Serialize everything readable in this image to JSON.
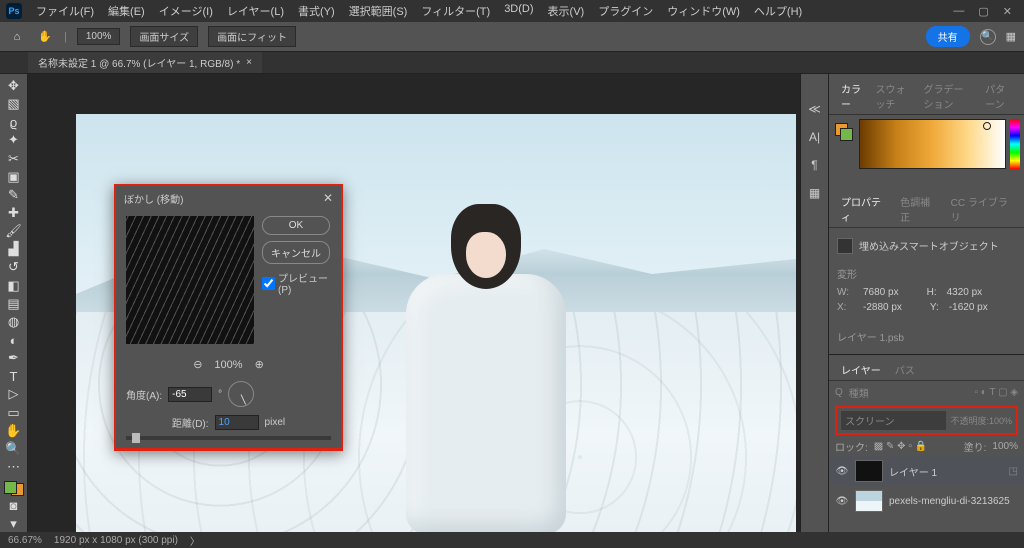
{
  "app": {
    "logo": "Ps"
  },
  "menu": [
    "ファイル(F)",
    "編集(E)",
    "イメージ(I)",
    "レイヤー(L)",
    "書式(Y)",
    "選択範囲(S)",
    "フィルター(T)",
    "3D(D)",
    "表示(V)",
    "プラグイン",
    "ウィンドウ(W)",
    "ヘルプ(H)"
  ],
  "optbar": {
    "zoom": "100%",
    "fit_screen": "画面サイズ",
    "fit_window": "画面にフィット",
    "share": "共有"
  },
  "tab": {
    "title": "名称未設定 1 @ 66.7% (レイヤー 1, RGB/8) *"
  },
  "dialog": {
    "title": "ぼかし (移動)",
    "ok": "OK",
    "cancel": "キャンセル",
    "preview_label": "プレビュー(P)",
    "zoom_pct": "100%",
    "angle_label": "角度(A):",
    "angle_value": "-65",
    "angle_unit": "°",
    "distance_label": "距離(D):",
    "distance_value": "10",
    "distance_unit": "pixel"
  },
  "right_tabs": {
    "color": [
      "カラー",
      "スウォッチ",
      "グラデーション",
      "パターン"
    ],
    "prop": [
      "プロパティ",
      "色調補正",
      "CC ライブラリ"
    ],
    "layers": [
      "レイヤー",
      "パス"
    ]
  },
  "properties": {
    "header": "埋め込みスマートオブジェクト",
    "section": "変形",
    "w_label": "W:",
    "w_value": "7680 px",
    "h_label": "H:",
    "h_value": "4320 px",
    "x_label": "X:",
    "x_value": "-2880 px",
    "y_label": "Y:",
    "y_value": "-1620 px",
    "source": "レイヤー 1.psb"
  },
  "layers": {
    "search_placeholder": "種類",
    "blend_mode": "スクリーン",
    "opacity_label": "不透明度:",
    "opacity": "100%",
    "lock_label": "ロック:",
    "fill_label": "塗り:",
    "fill": "100%",
    "items": [
      {
        "name": "レイヤー 1",
        "smart": true
      },
      {
        "name": "pexels-mengliu-di-3213625"
      }
    ]
  },
  "status": {
    "zoom": "66.67%",
    "doc": "1920 px x 1080 px (300 ppi)"
  }
}
